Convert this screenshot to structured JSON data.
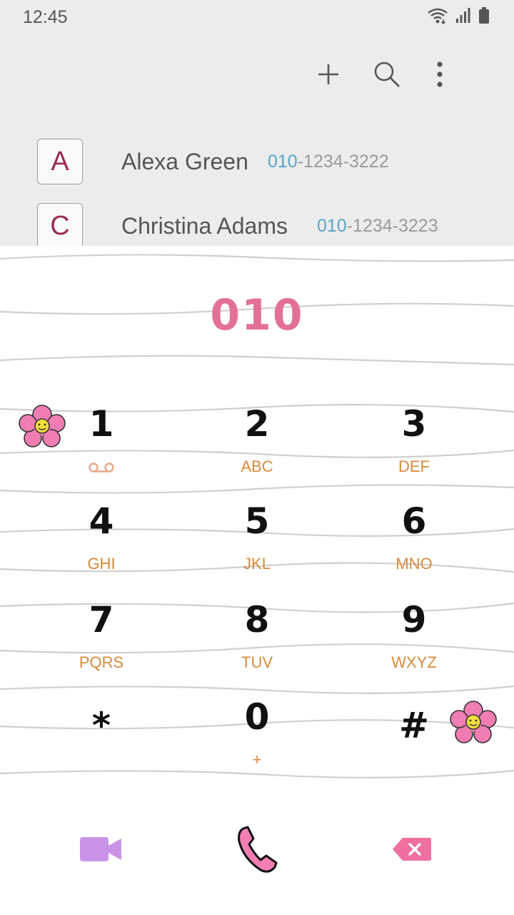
{
  "status_bar": {
    "time": "12:45",
    "icons": [
      "wifi-icon",
      "signal-icon",
      "battery-icon"
    ]
  },
  "action_bar": {
    "icons": [
      "add-icon",
      "search-icon",
      "more-options-icon"
    ]
  },
  "contacts": [
    {
      "initial": "A",
      "name": "Alexa Green",
      "number_match": "010",
      "number_rest": "-1234-3222"
    },
    {
      "initial": "C",
      "name": "Christina Adams",
      "number_match": "010",
      "number_rest": "-1234-3223"
    }
  ],
  "dialer": {
    "entered_number": "010",
    "keys": [
      {
        "digit": "1",
        "letters": ""
      },
      {
        "digit": "2",
        "letters": "ABC"
      },
      {
        "digit": "3",
        "letters": "DEF"
      },
      {
        "digit": "4",
        "letters": "GHI"
      },
      {
        "digit": "5",
        "letters": "JKL"
      },
      {
        "digit": "6",
        "letters": "MNO"
      },
      {
        "digit": "7",
        "letters": "PQRS"
      },
      {
        "digit": "8",
        "letters": "TUV"
      },
      {
        "digit": "9",
        "letters": "WXYZ"
      },
      {
        "digit": "*",
        "letters": ""
      },
      {
        "digit": "0",
        "letters": "+"
      },
      {
        "digit": "#",
        "letters": ""
      }
    ],
    "key1_icon": "voicemail-icon",
    "bottom_icons": [
      "video-call-icon",
      "phone-call-icon",
      "backspace-icon"
    ]
  },
  "colors": {
    "accent_pink": "#e4709a",
    "letters_orange": "#d68a3c",
    "number_match_blue": "#5aa4c8",
    "avatar_letter": "#9b2c57",
    "video_purple": "#c994e8",
    "top_background": "#ececec"
  }
}
